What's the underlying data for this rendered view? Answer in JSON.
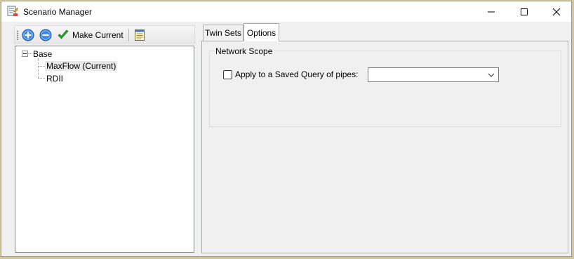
{
  "window": {
    "title": "Scenario Manager"
  },
  "toolbar": {
    "add_icon": "plus-circle-icon",
    "remove_icon": "minus-circle-icon",
    "make_current_icon": "checkmark-icon",
    "make_current_label": "Make Current",
    "properties_icon": "notepad-icon"
  },
  "tree": {
    "root": {
      "label": "Base",
      "expanded": true
    },
    "children": [
      {
        "label": "MaxFlow (Current)",
        "selected": true
      },
      {
        "label": "RDII",
        "selected": false
      }
    ]
  },
  "tabs": [
    {
      "label": "Twin Sets",
      "active": false
    },
    {
      "label": "Options",
      "active": true
    }
  ],
  "options": {
    "group_title": "Network Scope",
    "checkbox_label": "Apply to a Saved Query of pipes:",
    "checkbox_checked": false,
    "saved_query_value": ""
  },
  "colors": {
    "accent_blue": "#1f6fd0",
    "check_green": "#2ea32e"
  }
}
